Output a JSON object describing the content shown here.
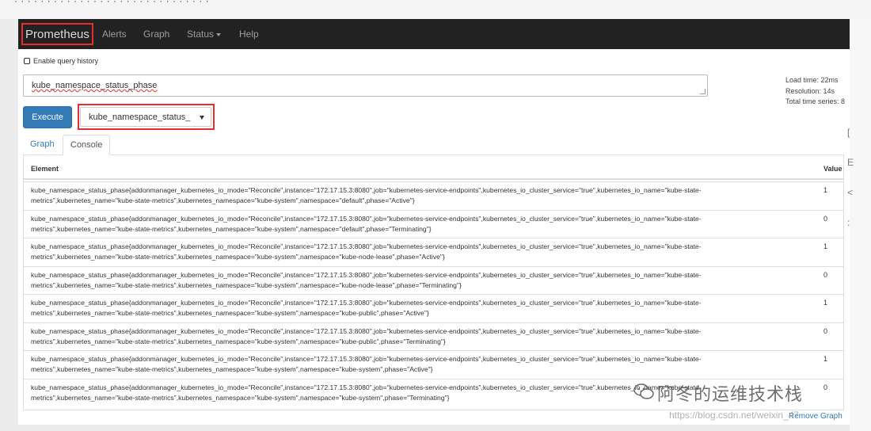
{
  "top_strip": {
    "text": "· · · ·  · ·  ·  ·  ·  · ·  · · ·  ·  ·  · ·  · ·  ·  · · ·  ·  · · · · ·"
  },
  "navbar": {
    "brand": "Prometheus",
    "items": [
      "Alerts",
      "Graph",
      "Status",
      "Help"
    ]
  },
  "query_history": {
    "label": "Enable query history"
  },
  "query": {
    "value": "kube_namespace_status_phase"
  },
  "metrics": {
    "load_time": "Load time: 22ms",
    "resolution": "Resolution: 14s",
    "total_series": "Total time series: 8"
  },
  "execute_label": "Execute",
  "metric_select": {
    "selected": "kube_namespace_status_"
  },
  "tabs": {
    "graph": "Graph",
    "console": "Console"
  },
  "table": {
    "headers": {
      "element": "Element",
      "value": "Value"
    },
    "rows": [
      {
        "element": "kube_namespace_status_phase{addonmanager_kubernetes_io_mode=\"Reconcile\",instance=\"172.17.15.3:8080\",job=\"kubernetes-service-endpoints\",kubernetes_io_cluster_service=\"true\",kubernetes_io_name=\"kube-state-metrics\",kubernetes_name=\"kube-state-metrics\",kubernetes_namespace=\"kube-system\",namespace=\"default\",phase=\"Active\"}",
        "value": "1"
      },
      {
        "element": "kube_namespace_status_phase{addonmanager_kubernetes_io_mode=\"Reconcile\",instance=\"172.17.15.3:8080\",job=\"kubernetes-service-endpoints\",kubernetes_io_cluster_service=\"true\",kubernetes_io_name=\"kube-state-metrics\",kubernetes_name=\"kube-state-metrics\",kubernetes_namespace=\"kube-system\",namespace=\"default\",phase=\"Terminating\"}",
        "value": "0"
      },
      {
        "element": "kube_namespace_status_phase{addonmanager_kubernetes_io_mode=\"Reconcile\",instance=\"172.17.15.3:8080\",job=\"kubernetes-service-endpoints\",kubernetes_io_cluster_service=\"true\",kubernetes_io_name=\"kube-state-metrics\",kubernetes_name=\"kube-state-metrics\",kubernetes_namespace=\"kube-system\",namespace=\"kube-node-lease\",phase=\"Active\"}",
        "value": "1"
      },
      {
        "element": "kube_namespace_status_phase{addonmanager_kubernetes_io_mode=\"Reconcile\",instance=\"172.17.15.3:8080\",job=\"kubernetes-service-endpoints\",kubernetes_io_cluster_service=\"true\",kubernetes_io_name=\"kube-state-metrics\",kubernetes_name=\"kube-state-metrics\",kubernetes_namespace=\"kube-system\",namespace=\"kube-node-lease\",phase=\"Terminating\"}",
        "value": "0"
      },
      {
        "element": "kube_namespace_status_phase{addonmanager_kubernetes_io_mode=\"Reconcile\",instance=\"172.17.15.3:8080\",job=\"kubernetes-service-endpoints\",kubernetes_io_cluster_service=\"true\",kubernetes_io_name=\"kube-state-metrics\",kubernetes_name=\"kube-state-metrics\",kubernetes_namespace=\"kube-system\",namespace=\"kube-public\",phase=\"Active\"}",
        "value": "1"
      },
      {
        "element": "kube_namespace_status_phase{addonmanager_kubernetes_io_mode=\"Reconcile\",instance=\"172.17.15.3:8080\",job=\"kubernetes-service-endpoints\",kubernetes_io_cluster_service=\"true\",kubernetes_io_name=\"kube-state-metrics\",kubernetes_name=\"kube-state-metrics\",kubernetes_namespace=\"kube-system\",namespace=\"kube-public\",phase=\"Terminating\"}",
        "value": "0"
      },
      {
        "element": "kube_namespace_status_phase{addonmanager_kubernetes_io_mode=\"Reconcile\",instance=\"172.17.15.3:8080\",job=\"kubernetes-service-endpoints\",kubernetes_io_cluster_service=\"true\",kubernetes_io_name=\"kube-state-metrics\",kubernetes_name=\"kube-state-metrics\",kubernetes_namespace=\"kube-system\",namespace=\"kube-system\",phase=\"Active\"}",
        "value": "1"
      },
      {
        "element": "kube_namespace_status_phase{addonmanager_kubernetes_io_mode=\"Reconcile\",instance=\"172.17.15.3:8080\",job=\"kubernetes-service-endpoints\",kubernetes_io_cluster_service=\"true\",kubernetes_io_name=\"kube-state-metrics\",kubernetes_name=\"kube-state-metrics\",kubernetes_namespace=\"kube-system\",namespace=\"kube-system\",phase=\"Terminating\"}",
        "value": "0"
      }
    ]
  },
  "remove_graph_label": "Remove Graph",
  "watermark": {
    "title": "阿冬的运维技术栈",
    "url": "https://blog.csdn.net/weixin_47"
  },
  "side_glyphs": [
    "[",
    "E",
    "<",
    ":"
  ],
  "colors": {
    "navbar_bg": "#222222",
    "highlight_red": "#e52e2e",
    "primary_blue": "#337ab7"
  }
}
